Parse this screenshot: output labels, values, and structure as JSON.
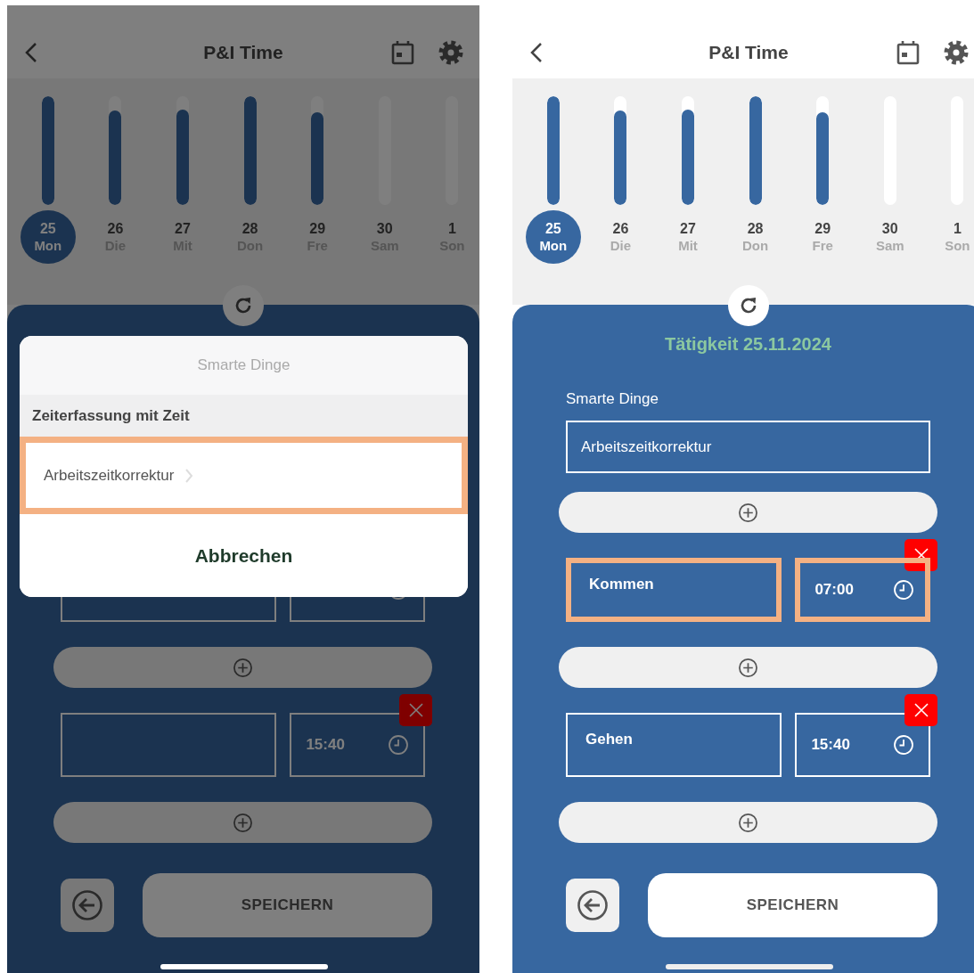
{
  "phones": [
    {
      "dimmed": true,
      "header": {
        "title": "P&I Time"
      },
      "days": [
        {
          "day": "25",
          "weekday": "Mon",
          "level": 1,
          "selected": true
        },
        {
          "day": "26",
          "weekday": "Die",
          "level": 0.87,
          "selected": false
        },
        {
          "day": "27",
          "weekday": "Mit",
          "level": 0.88,
          "selected": false
        },
        {
          "day": "28",
          "weekday": "Don",
          "level": 1,
          "selected": false
        },
        {
          "day": "29",
          "weekday": "Fre",
          "level": 0.85,
          "selected": false
        },
        {
          "day": "30",
          "weekday": "Sam",
          "level": 0,
          "selected": false
        },
        {
          "day": "1",
          "weekday": "Son",
          "level": 0,
          "selected": false
        }
      ],
      "items": [
        {
          "kind": "entry",
          "delete_button": false,
          "highlighted": false
        },
        {
          "kind": "add"
        },
        {
          "kind": "entry",
          "time": "15:40",
          "delete_button": true,
          "highlighted": false
        },
        {
          "kind": "add"
        }
      ],
      "save_label": "SPEICHERN",
      "sheet": {
        "title": "Smarte Dinge",
        "section": "Zeiterfassung mit Zeit",
        "options": [
          {
            "label": "Arbeitszeitkorrektur",
            "highlighted": true
          }
        ],
        "cancel": "Abbrechen"
      }
    },
    {
      "dimmed": false,
      "header": {
        "title": "P&I Time"
      },
      "days": [
        {
          "day": "25",
          "weekday": "Mon",
          "level": 1,
          "selected": true
        },
        {
          "day": "26",
          "weekday": "Die",
          "level": 0.87,
          "selected": false
        },
        {
          "day": "27",
          "weekday": "Mit",
          "level": 0.88,
          "selected": false
        },
        {
          "day": "28",
          "weekday": "Don",
          "level": 1,
          "selected": false
        },
        {
          "day": "29",
          "weekday": "Fre",
          "level": 0.85,
          "selected": false
        },
        {
          "day": "30",
          "weekday": "Sam",
          "level": 0,
          "selected": false
        },
        {
          "day": "1",
          "weekday": "Son",
          "level": 0,
          "selected": false
        }
      ],
      "activity_title": "Tätigkeit 25.11.2024",
      "field_label": "Smarte Dinge",
      "field_value": "Arbeitszeitkorrektur",
      "items": [
        {
          "kind": "add"
        },
        {
          "kind": "entry",
          "label": "Kommen",
          "time": "07:00",
          "delete_button": true,
          "highlighted": true
        },
        {
          "kind": "add"
        },
        {
          "kind": "entry",
          "label": "Gehen",
          "time": "15:40",
          "delete_button": true,
          "highlighted": false
        },
        {
          "kind": "add"
        }
      ],
      "save_label": "SPEICHERN"
    }
  ]
}
